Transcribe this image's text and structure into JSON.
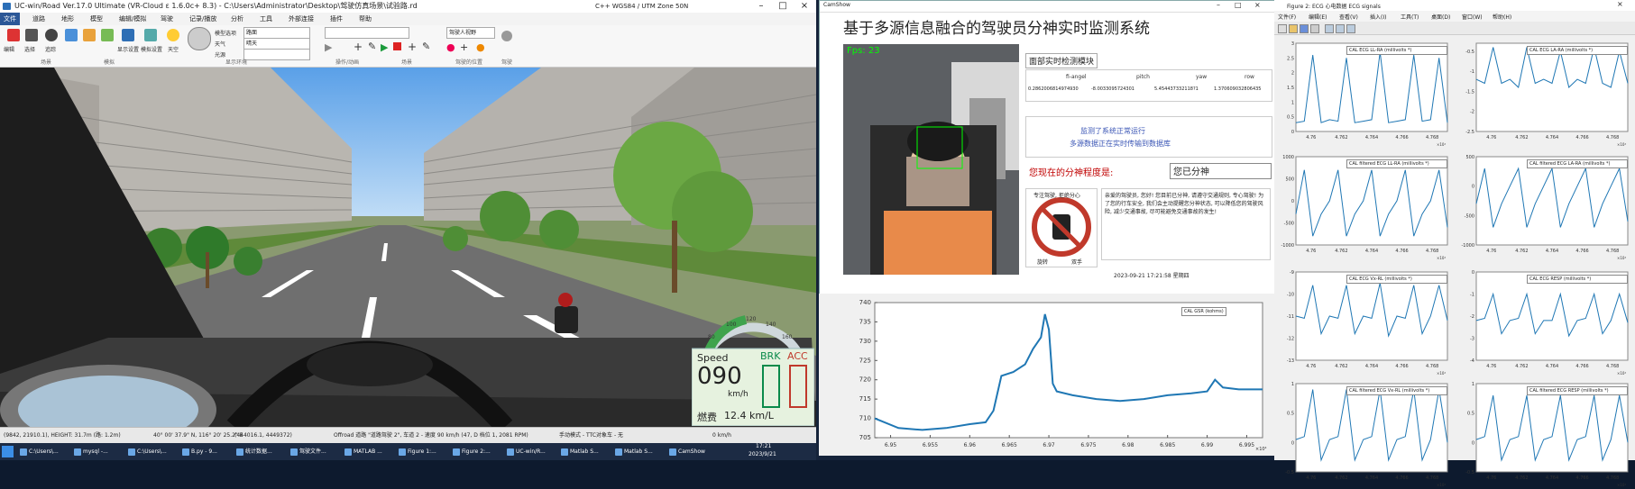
{
  "sim_window": {
    "title": "UC-win/Road Ver.17.0 Ultimate (VR-Cloud ε 1.6.0c+ 8.3) - C:\\Users\\Administrator\\Desktop\\驾驶仿真场景\\试验路.rd",
    "title_right": "C++ WGS84 / UTM Zone 50N",
    "menu": [
      "文件",
      "道路",
      "地形",
      "模型",
      "编辑/模拟",
      "驾驶",
      "记录/播放",
      "分析",
      "工具",
      "外部连接",
      "插件",
      "帮助"
    ],
    "ribbon": {
      "field_model": "模型选项",
      "field_model_value": "路面",
      "field_weather": "天气",
      "field_weather_value": "晴天",
      "field_light": "光源",
      "field_view": "摄像机视角",
      "field_view_value": "驾驶人视野",
      "groups": [
        "场景",
        "模拟",
        "显示环境",
        "操作/动画",
        "场景",
        "驾驶的位置",
        "驾驶"
      ],
      "labels": [
        "编辑",
        "选择",
        "追踪",
        "显示设置",
        "模拟设置",
        "天空"
      ]
    },
    "status_bar": [
      "(9842, 21910.1), HEIGHT: 31.7m (路: 1.2m)",
      "40° 00' 37.9\" N, 116° 20' 25.2\" E",
      "(444016.1, 4449372)",
      "Offroad 道路 \"道路驾驶 2\", 车道 2 - 速度 90 km/h (47, D 档位 1, 2081 RPM)",
      "手动模式 - TTC对象车 - 无",
      "0 km/h"
    ],
    "hud": {
      "speed_label": "Speed",
      "speed_value": "090",
      "speed_unit": "km/h",
      "brk_label": "BRK",
      "acc_label": "ACC",
      "fuel_label": "燃费",
      "fuel_value": "12.4 km/L",
      "gauge_ticks": [
        "80",
        "100",
        "120",
        "140",
        "160"
      ],
      "brake_level": 0.0,
      "accel_level": 0.0
    }
  },
  "taskbar": {
    "items": [
      "C:\\Users\\...",
      "mysql -...",
      "C:\\Users\\...",
      "B.py - 9...",
      "统计数据...",
      "驾驶文件...",
      "MATLAB ...",
      "Figure 1:...",
      "Figure 2:...",
      "UC-win/R...",
      "Matlab S...",
      "Matlab S...",
      "CamShow"
    ],
    "time": "17:21",
    "date": "2023/9/21"
  },
  "camshow": {
    "window_title": "CamShow",
    "system_title": "基于多源信息融合的驾驶员分神实时监测系统",
    "fps_overlay": "Fps:  23",
    "face_module_title": "面部实时检测模块",
    "headers": [
      "fi-angel",
      "pitch",
      "yaw",
      "row"
    ],
    "values": [
      "0.2862006814974930",
      "-8.0033095724301",
      "5.454437332118?1",
      "1.370609032806435"
    ],
    "status_lines": [
      "监测了系统正常运行",
      "多源数据正在实时传输到数据库"
    ],
    "distraction_label": "您现在的分神程度是:",
    "distraction_value": "您已分神",
    "sign_top": "专注驾驶, 拒绝分心",
    "sign_bottom_left": "旋转",
    "sign_bottom_right": "双手",
    "message": "亲爱的驾驶员, 您好! 您目前已分神, 请遵守交通规则, 专心驾驶! 为了您的行车安全, 我们会主动提醒您分神状态, 可以降低您的驾驶风险, 减少交通事故, 尽可能避免交通事故的发生!",
    "timestamp": "2023-09-21  17:21:58  星期四"
  },
  "gsr_figure": {
    "chart_data": {
      "type": "line",
      "title": "",
      "legend": "CAL GSR (kohms)",
      "xlabel": "",
      "ylabel": "",
      "x_ticks": [
        "6.95",
        "6.955",
        "6.96",
        "6.965",
        "6.97",
        "6.975",
        "6.98",
        "6.985",
        "6.99",
        "6.995"
      ],
      "x_exponent": "×10⁴",
      "y_ticks": [
        "705",
        "710",
        "715",
        "720",
        "725",
        "730",
        "735",
        "740"
      ],
      "ylim": [
        705,
        740
      ],
      "xlim": [
        6.948,
        6.997
      ],
      "x": [
        6.948,
        6.951,
        6.954,
        6.957,
        6.96,
        6.962,
        6.963,
        6.964,
        6.9655,
        6.967,
        6.968,
        6.969,
        6.9695,
        6.97,
        6.9705,
        6.971,
        6.973,
        6.976,
        6.979,
        6.982,
        6.985,
        6.988,
        6.99,
        6.991,
        6.992,
        6.994,
        6.997
      ],
      "y": [
        710,
        707.5,
        707,
        707.5,
        708.5,
        709,
        712,
        721,
        722,
        724,
        728,
        731,
        737,
        733,
        719,
        717,
        716,
        715,
        714.5,
        715,
        716,
        716.5,
        717,
        720,
        718,
        717.5,
        717.5
      ]
    }
  },
  "ecg_figure": {
    "window_title": "Figure 2: ECG 心电数据 ECG signals",
    "menu": [
      "文件(F)",
      "编辑(E)",
      "查看(V)",
      "插入(I)",
      "工具(T)",
      "桌面(D)",
      "窗口(W)",
      "帮助(H)"
    ],
    "x_ticks": [
      "4.76",
      "4.762",
      "4.764",
      "4.766",
      "4.768"
    ],
    "x_exponent": "×10⁴",
    "chart_data": [
      {
        "type": "line",
        "title": "",
        "legend": "CAL ECG LL-RA (millivolts *)",
        "y_ticks": [
          "3",
          "2.5",
          "2",
          "1.5",
          "1",
          "0.5",
          "0"
        ],
        "ylim": [
          0,
          3
        ],
        "series": [
          {
            "values": [
              0.3,
              0.35,
              2.6,
              0.3,
              0.4,
              0.35,
              2.5,
              0.3,
              0.35,
              0.4,
              2.7,
              0.3,
              0.35,
              0.4,
              2.6,
              0.35,
              0.4,
              2.5,
              0.3
            ]
          }
        ]
      },
      {
        "type": "line",
        "title": "",
        "legend": "CAL ECG LA-RA (millivolts *)",
        "y_ticks": [
          "-0.5",
          "-1",
          "-1.5",
          "-2",
          "-2.5"
        ],
        "ylim": [
          -2.5,
          -0.3
        ],
        "series": [
          {
            "values": [
              -1.2,
              -1.3,
              -0.4,
              -1.3,
              -1.2,
              -1.4,
              -0.4,
              -1.3,
              -1.2,
              -1.3,
              -0.5,
              -1.4,
              -1.2,
              -1.3,
              -0.4,
              -1.3,
              -1.4,
              -0.5,
              -1.3
            ]
          }
        ]
      },
      {
        "type": "line",
        "title": "",
        "legend": "CAL filtered ECG LL-RA (millivolts *)",
        "y_ticks": [
          "1000",
          "500",
          "0",
          "-500",
          "-1000"
        ],
        "ylim": [
          -1000,
          1000
        ],
        "series": [
          {
            "values": [
              -300,
              700,
              -800,
              -300,
              0,
              700,
              -800,
              -300,
              0,
              700,
              -800,
              -300,
              0,
              700,
              -800,
              -300,
              0,
              700,
              -600
            ]
          }
        ]
      },
      {
        "type": "line",
        "title": "",
        "legend": "CAL filtered ECG LA-RA (millivolts *)",
        "y_ticks": [
          "500",
          "0",
          "-500",
          "-1000"
        ],
        "ylim": [
          -1000,
          500
        ],
        "series": [
          {
            "values": [
              -300,
              300,
              -700,
              -300,
              0,
              300,
              -700,
              -300,
              0,
              300,
              -700,
              -300,
              0,
              300,
              -700,
              -300,
              0,
              300,
              -600
            ]
          }
        ]
      },
      {
        "type": "line",
        "title": "",
        "legend": "CAL ECG Vx-RL (millivolts *)",
        "y_ticks": [
          "-9",
          "-10",
          "-11",
          "-12",
          "-13"
        ],
        "ylim": [
          -13,
          -9
        ],
        "series": [
          {
            "values": [
              -11,
              -11.1,
              -9.6,
              -11.8,
              -11,
              -11.1,
              -9.6,
              -11.8,
              -11,
              -11.1,
              -9.5,
              -11.9,
              -11,
              -11.1,
              -9.6,
              -11.8,
              -11,
              -9.6,
              -11.2
            ]
          }
        ]
      },
      {
        "type": "line",
        "title": "",
        "legend": "CAL ECG RESP (millivolts *)",
        "y_ticks": [
          "0",
          "-1",
          "-2",
          "-3",
          "-4"
        ],
        "ylim": [
          -4,
          0
        ],
        "series": [
          {
            "values": [
              -2.2,
              -2.1,
              -1.0,
              -2.8,
              -2.2,
              -2.1,
              -1.0,
              -2.8,
              -2.2,
              -2.2,
              -1.0,
              -2.9,
              -2.2,
              -2.1,
              -1.0,
              -2.8,
              -2.2,
              -1.0,
              -2.3
            ]
          }
        ]
      },
      {
        "type": "line",
        "title": "",
        "legend": "CAL filtered ECG Vx-RL (millivolts *)",
        "y_ticks": [
          "1",
          "0.5",
          "0",
          "-0.5"
        ],
        "ylim": [
          -0.5,
          1
        ],
        "series": [
          {
            "values": [
              0.05,
              0.1,
              0.9,
              -0.3,
              0.05,
              0.1,
              0.9,
              -0.3,
              0.05,
              0.1,
              0.9,
              -0.3,
              0.05,
              0.1,
              0.9,
              -0.3,
              0.05,
              0.9,
              0.0
            ]
          }
        ]
      },
      {
        "type": "line",
        "title": "",
        "legend": "CAL filtered ECG RESP (millivolts *)",
        "y_ticks": [
          "1",
          "0.5",
          "0",
          "-0.5"
        ],
        "ylim": [
          -0.5,
          1
        ],
        "series": [
          {
            "values": [
              0.05,
              0.1,
              0.8,
              -0.3,
              0.05,
              0.1,
              0.8,
              -0.3,
              0.05,
              0.1,
              0.8,
              -0.3,
              0.05,
              0.1,
              0.8,
              -0.3,
              0.05,
              0.8,
              0.0
            ]
          }
        ]
      }
    ]
  },
  "colors": {
    "accent": "#2b5797",
    "hud_bg": "#e6f2df",
    "hud_text": "#1a1a1a",
    "brk": "#0a8a4a",
    "acc": "#c0392b",
    "fps": "#00ff00",
    "distraction": "#c00000",
    "plot_line": "#1f77b4"
  }
}
